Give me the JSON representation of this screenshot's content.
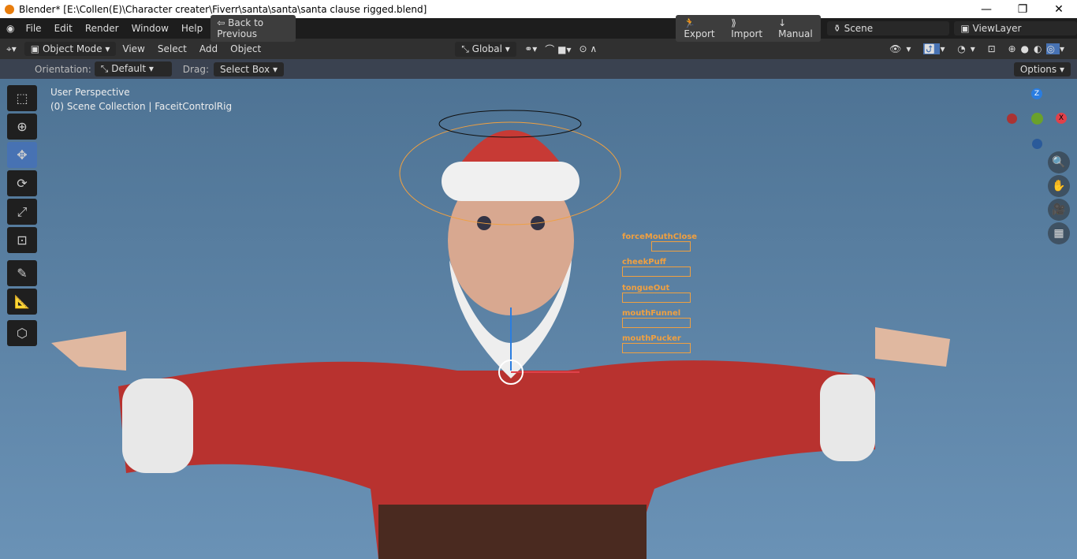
{
  "window": {
    "title": "Blender* [E:\\Collen(E)\\Character creater\\Fiverr\\santa\\santa\\santa clause rigged.blend]",
    "minimize": "—",
    "restore": "❐",
    "close": "✕"
  },
  "menubar": {
    "items": [
      "File",
      "Edit",
      "Render",
      "Window",
      "Help"
    ],
    "back": "Back to Previous",
    "export": "Export",
    "import": "Import",
    "manual": "Manual",
    "scene": "Scene",
    "view_layer": "ViewLayer"
  },
  "header": {
    "mode": "Object Mode",
    "menus": [
      "View",
      "Select",
      "Add",
      "Object"
    ],
    "transform_orientation": "Global"
  },
  "tool_settings": {
    "orientation_label": "Orientation:",
    "orientation": "Default",
    "drag_label": "Drag:",
    "drag": "Select Box",
    "options": "Options"
  },
  "viewport": {
    "perspective": "User Perspective",
    "collection": "(0) Scene Collection | FaceitControlRig"
  },
  "gizmo": {
    "z": "Z",
    "x": "X",
    "colors": {
      "x": "#e0414a",
      "y": "#6aa12b",
      "z": "#2a7de0"
    }
  },
  "shape_keys": [
    "forceMouthClose",
    "cheekPuff",
    "tongueOut",
    "mouthFunnel",
    "mouthPucker"
  ],
  "accent": "#4772b3"
}
